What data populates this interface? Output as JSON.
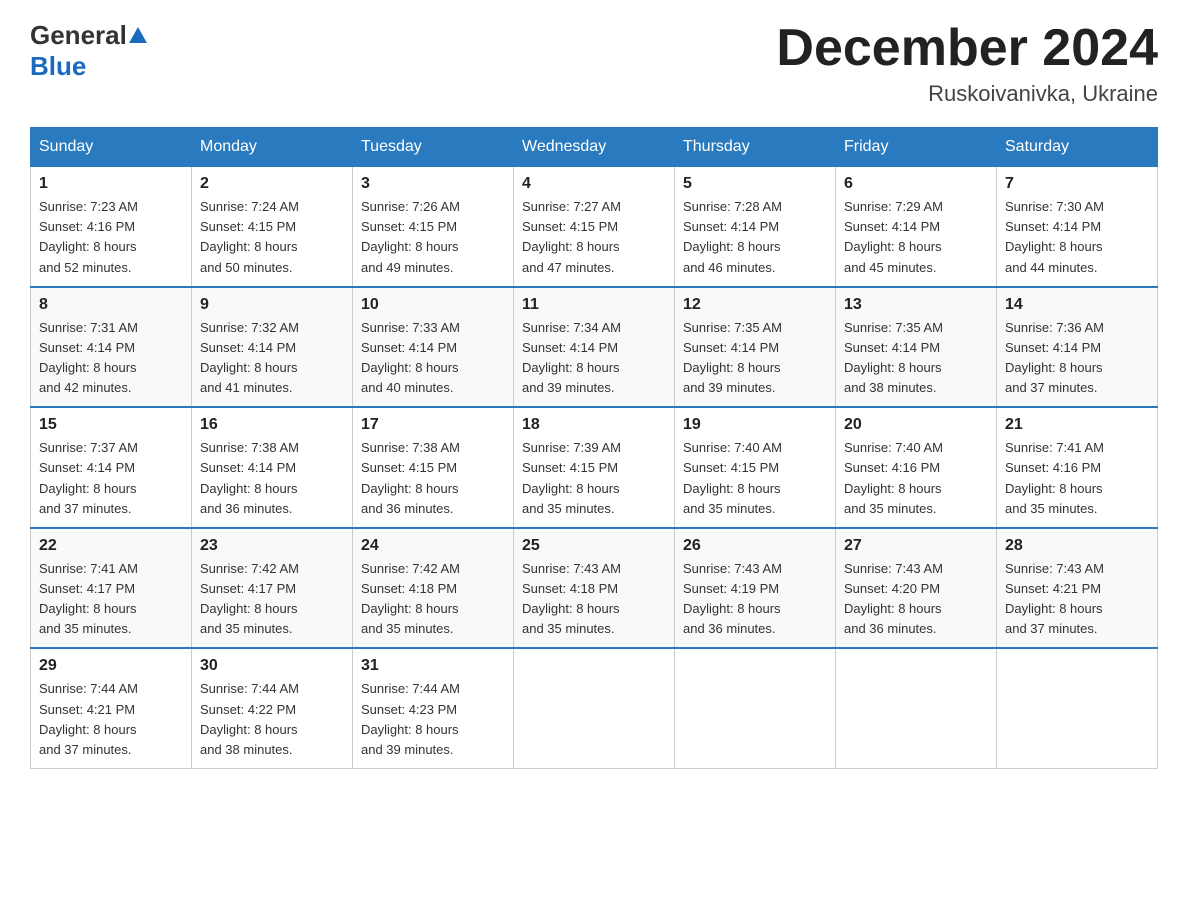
{
  "header": {
    "logo_general": "General",
    "logo_blue": "Blue",
    "month_title": "December 2024",
    "location": "Ruskoivanivka, Ukraine"
  },
  "days_of_week": [
    "Sunday",
    "Monday",
    "Tuesday",
    "Wednesday",
    "Thursday",
    "Friday",
    "Saturday"
  ],
  "weeks": [
    [
      {
        "day": "1",
        "sunrise": "7:23 AM",
        "sunset": "4:16 PM",
        "daylight": "8 hours and 52 minutes."
      },
      {
        "day": "2",
        "sunrise": "7:24 AM",
        "sunset": "4:15 PM",
        "daylight": "8 hours and 50 minutes."
      },
      {
        "day": "3",
        "sunrise": "7:26 AM",
        "sunset": "4:15 PM",
        "daylight": "8 hours and 49 minutes."
      },
      {
        "day": "4",
        "sunrise": "7:27 AM",
        "sunset": "4:15 PM",
        "daylight": "8 hours and 47 minutes."
      },
      {
        "day": "5",
        "sunrise": "7:28 AM",
        "sunset": "4:14 PM",
        "daylight": "8 hours and 46 minutes."
      },
      {
        "day": "6",
        "sunrise": "7:29 AM",
        "sunset": "4:14 PM",
        "daylight": "8 hours and 45 minutes."
      },
      {
        "day": "7",
        "sunrise": "7:30 AM",
        "sunset": "4:14 PM",
        "daylight": "8 hours and 44 minutes."
      }
    ],
    [
      {
        "day": "8",
        "sunrise": "7:31 AM",
        "sunset": "4:14 PM",
        "daylight": "8 hours and 42 minutes."
      },
      {
        "day": "9",
        "sunrise": "7:32 AM",
        "sunset": "4:14 PM",
        "daylight": "8 hours and 41 minutes."
      },
      {
        "day": "10",
        "sunrise": "7:33 AM",
        "sunset": "4:14 PM",
        "daylight": "8 hours and 40 minutes."
      },
      {
        "day": "11",
        "sunrise": "7:34 AM",
        "sunset": "4:14 PM",
        "daylight": "8 hours and 39 minutes."
      },
      {
        "day": "12",
        "sunrise": "7:35 AM",
        "sunset": "4:14 PM",
        "daylight": "8 hours and 39 minutes."
      },
      {
        "day": "13",
        "sunrise": "7:35 AM",
        "sunset": "4:14 PM",
        "daylight": "8 hours and 38 minutes."
      },
      {
        "day": "14",
        "sunrise": "7:36 AM",
        "sunset": "4:14 PM",
        "daylight": "8 hours and 37 minutes."
      }
    ],
    [
      {
        "day": "15",
        "sunrise": "7:37 AM",
        "sunset": "4:14 PM",
        "daylight": "8 hours and 37 minutes."
      },
      {
        "day": "16",
        "sunrise": "7:38 AM",
        "sunset": "4:14 PM",
        "daylight": "8 hours and 36 minutes."
      },
      {
        "day": "17",
        "sunrise": "7:38 AM",
        "sunset": "4:15 PM",
        "daylight": "8 hours and 36 minutes."
      },
      {
        "day": "18",
        "sunrise": "7:39 AM",
        "sunset": "4:15 PM",
        "daylight": "8 hours and 35 minutes."
      },
      {
        "day": "19",
        "sunrise": "7:40 AM",
        "sunset": "4:15 PM",
        "daylight": "8 hours and 35 minutes."
      },
      {
        "day": "20",
        "sunrise": "7:40 AM",
        "sunset": "4:16 PM",
        "daylight": "8 hours and 35 minutes."
      },
      {
        "day": "21",
        "sunrise": "7:41 AM",
        "sunset": "4:16 PM",
        "daylight": "8 hours and 35 minutes."
      }
    ],
    [
      {
        "day": "22",
        "sunrise": "7:41 AM",
        "sunset": "4:17 PM",
        "daylight": "8 hours and 35 minutes."
      },
      {
        "day": "23",
        "sunrise": "7:42 AM",
        "sunset": "4:17 PM",
        "daylight": "8 hours and 35 minutes."
      },
      {
        "day": "24",
        "sunrise": "7:42 AM",
        "sunset": "4:18 PM",
        "daylight": "8 hours and 35 minutes."
      },
      {
        "day": "25",
        "sunrise": "7:43 AM",
        "sunset": "4:18 PM",
        "daylight": "8 hours and 35 minutes."
      },
      {
        "day": "26",
        "sunrise": "7:43 AM",
        "sunset": "4:19 PM",
        "daylight": "8 hours and 36 minutes."
      },
      {
        "day": "27",
        "sunrise": "7:43 AM",
        "sunset": "4:20 PM",
        "daylight": "8 hours and 36 minutes."
      },
      {
        "day": "28",
        "sunrise": "7:43 AM",
        "sunset": "4:21 PM",
        "daylight": "8 hours and 37 minutes."
      }
    ],
    [
      {
        "day": "29",
        "sunrise": "7:44 AM",
        "sunset": "4:21 PM",
        "daylight": "8 hours and 37 minutes."
      },
      {
        "day": "30",
        "sunrise": "7:44 AM",
        "sunset": "4:22 PM",
        "daylight": "8 hours and 38 minutes."
      },
      {
        "day": "31",
        "sunrise": "7:44 AM",
        "sunset": "4:23 PM",
        "daylight": "8 hours and 39 minutes."
      },
      null,
      null,
      null,
      null
    ]
  ],
  "labels": {
    "sunrise": "Sunrise:",
    "sunset": "Sunset:",
    "daylight": "Daylight:"
  }
}
